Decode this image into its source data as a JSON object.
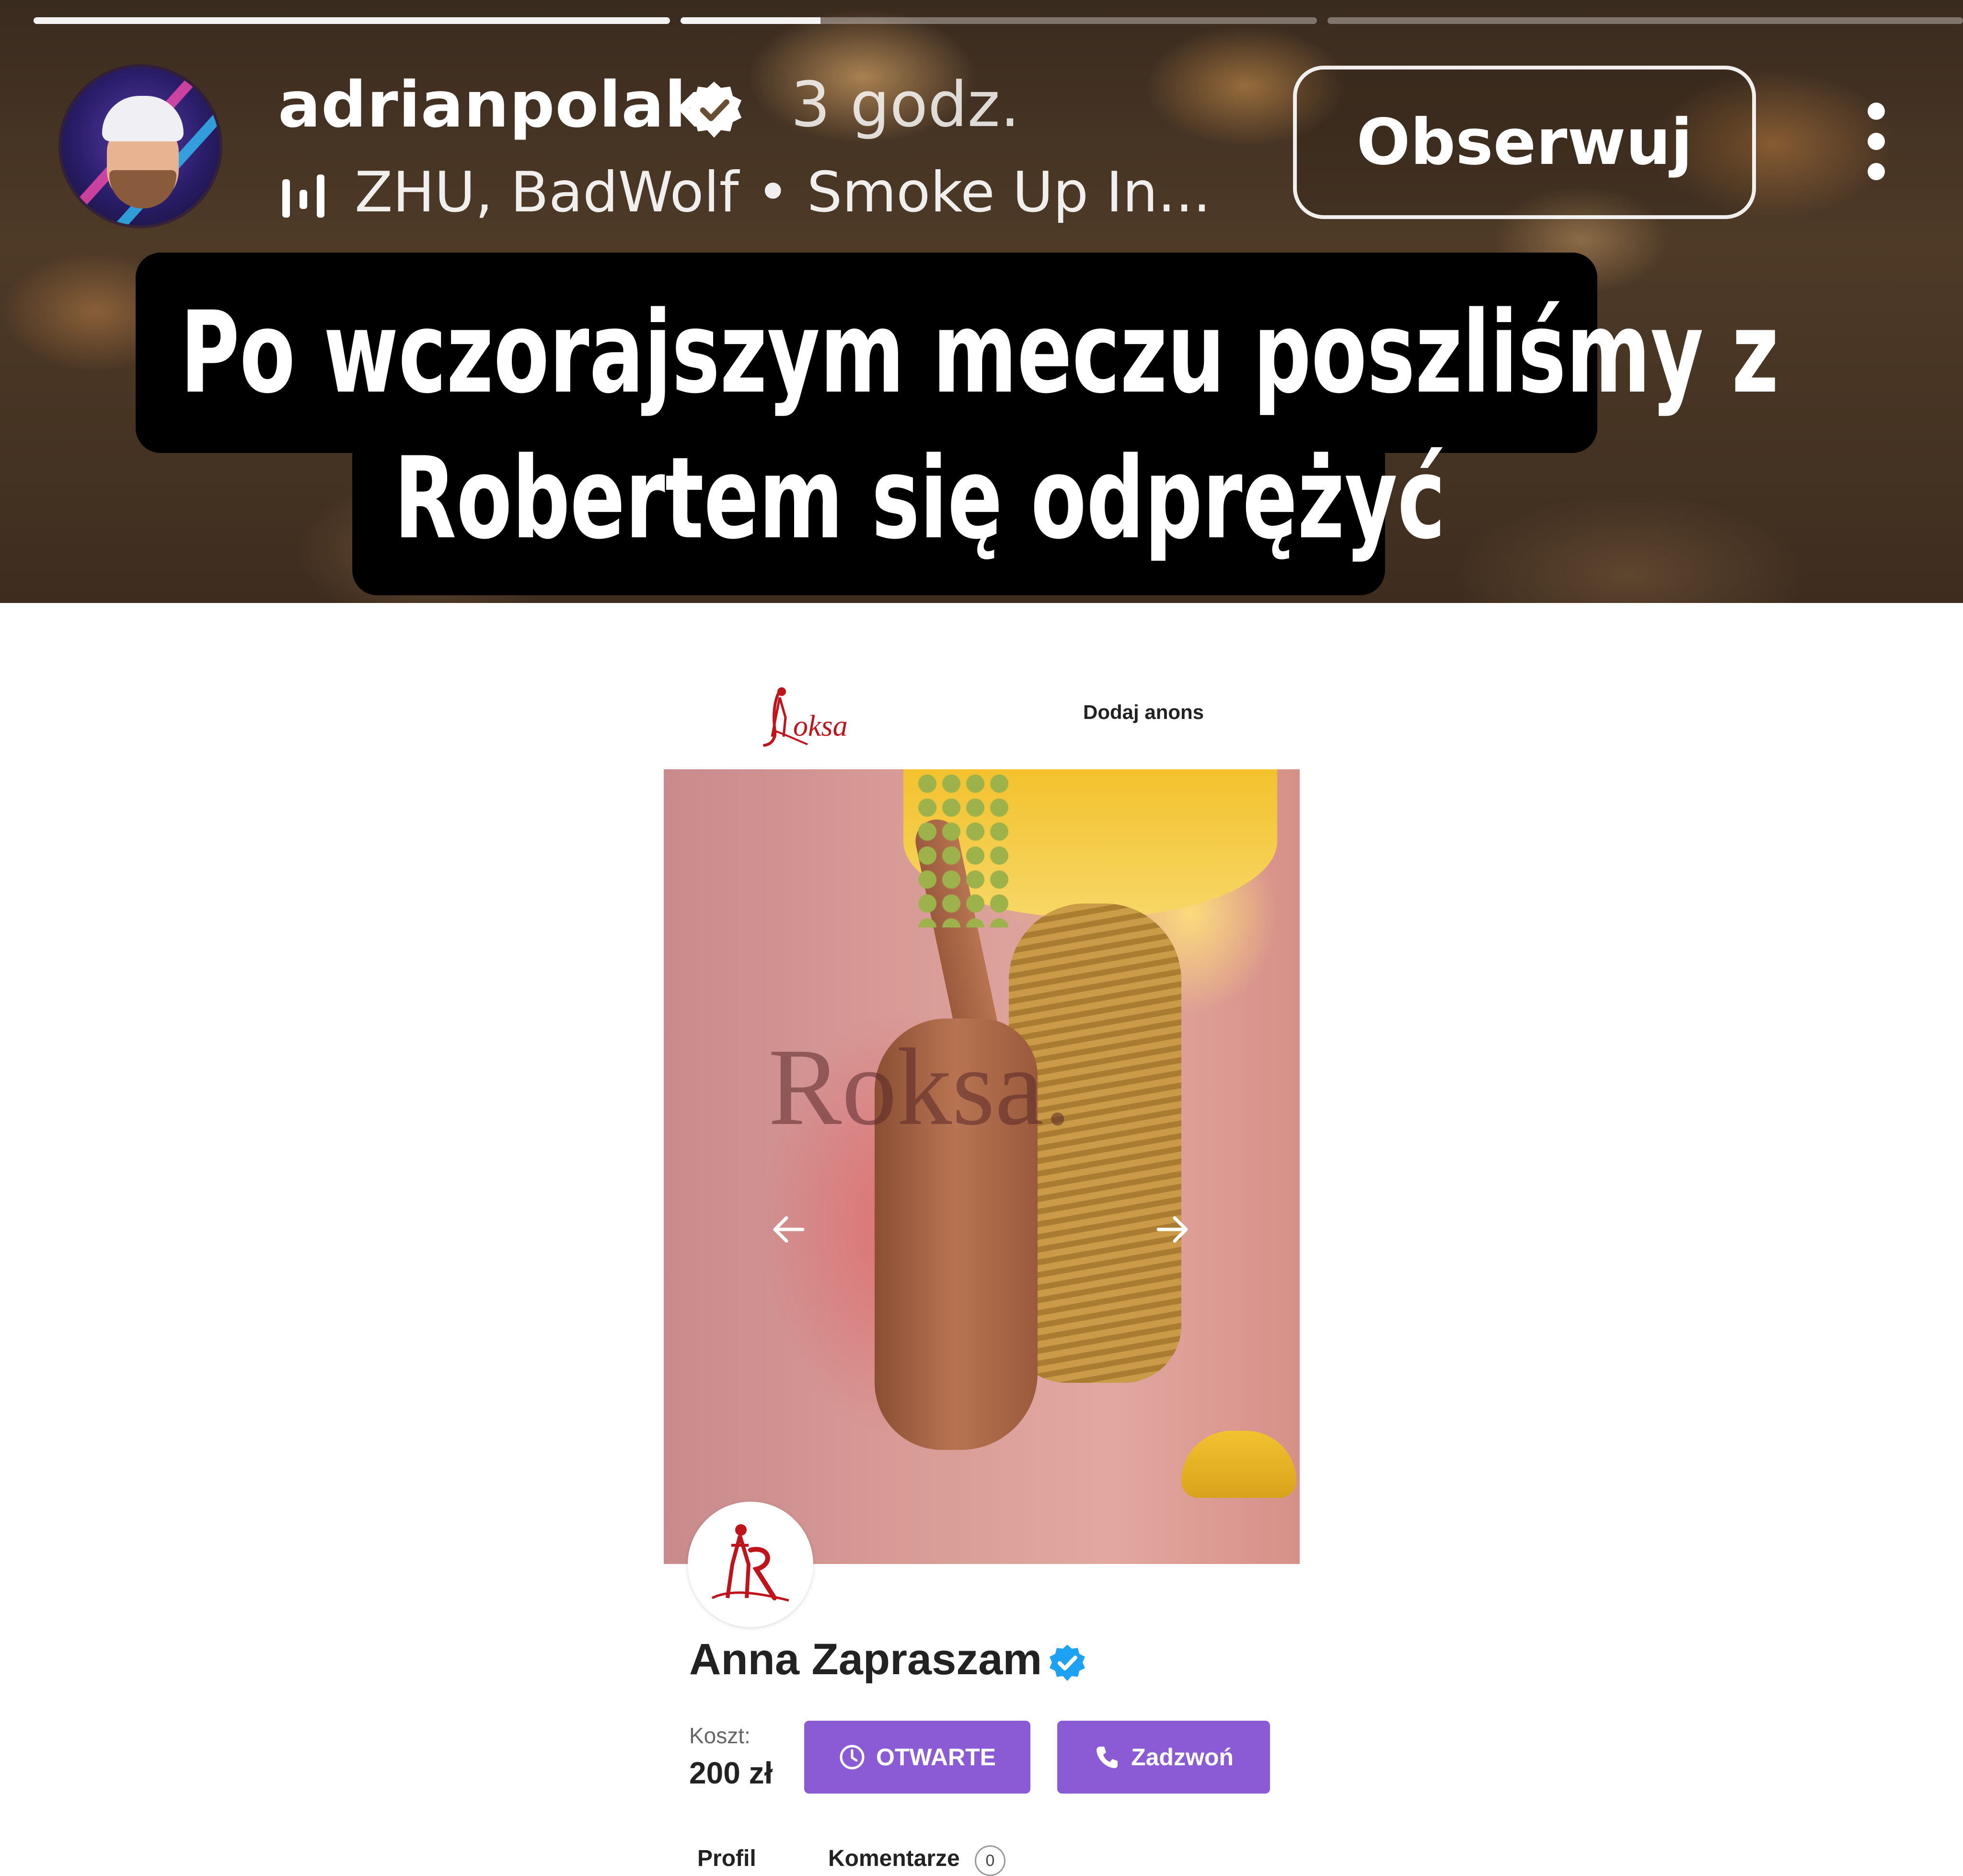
{
  "story": {
    "progress": [
      1.0,
      0.22,
      0.0
    ],
    "username": "adrianpolak",
    "time_ago": "3 godz.",
    "music": "ZHU, BadWolf • Smoke Up In...",
    "follow_label": "Obserwuj",
    "caption_line_1": "Po wczorajszym meczu poszliśmy z",
    "caption_line_2": "Robertem się odprężyć",
    "icons": [
      "verified-badge",
      "music-bars-icon",
      "more-menu-icon"
    ],
    "colors": {
      "text": "#ffffff",
      "caption_bg": "#000000"
    }
  },
  "listing": {
    "header": {
      "logo_text": "Roksa",
      "add_listing": "Dodaj anons"
    },
    "photo": {
      "watermark": "Roksa.",
      "icons": [
        "prev-arrow-icon",
        "next-arrow-icon"
      ]
    },
    "profile": {
      "name": "Anna Zapraszam",
      "verified": true
    },
    "cost": {
      "label": "Koszt:",
      "value": "200 zł"
    },
    "buttons": {
      "open": "OTWARTE",
      "call": "Zadzwoń"
    },
    "tabs": [
      {
        "label": "Profil"
      },
      {
        "label": "Komentarze",
        "count": "0"
      }
    ],
    "colors": {
      "accent": "#8b5bd6",
      "verified": "#1da1f2",
      "logo_red": "#c0141c"
    }
  }
}
